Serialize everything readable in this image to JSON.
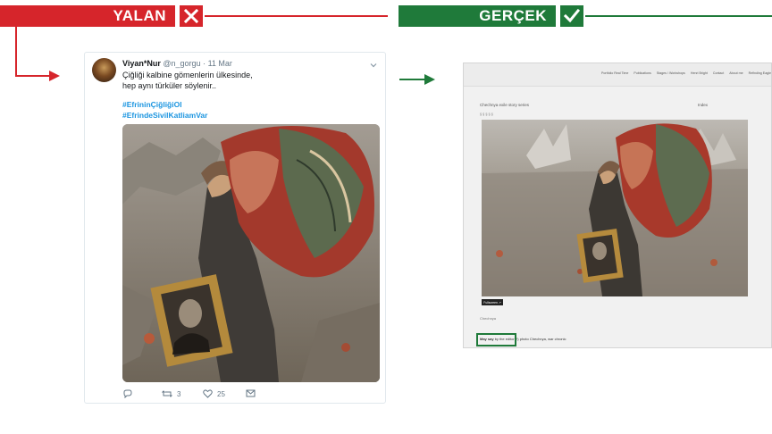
{
  "header": {
    "false_label": "YALAN",
    "true_label": "GERÇEK",
    "colors": {
      "false": "#d6252b",
      "true": "#1f7a3a"
    },
    "false_icon": "x-mark-icon",
    "true_icon": "check-mark-icon"
  },
  "tweet": {
    "name": "Viyan*Nur",
    "handle": "@n_gorgu",
    "dot": "·",
    "date": "11 Mar",
    "text_line1": "Çiğliği kalbine gömenlerin ülkesinde,",
    "text_line2": "hep aynı türküler söylenir..",
    "hashtag1": "#EfrininÇiğliğiOl",
    "hashtag2": "#EfrindeSivilKatliamVar",
    "photo_alt": "Woman carrying rugs and a framed portrait among ruins",
    "reply_count": "",
    "retweet_count": "3",
    "like_count": "25"
  },
  "site": {
    "nav": [
      "Portfolio Real Time",
      "Publications",
      "Stages / Workshops",
      "Henri Bright",
      "Contact",
      "About me",
      "Refinding Eagle"
    ],
    "title": "Chechnya exile story series",
    "info": "Index",
    "subtitle": "§ § § § §",
    "button": "Fullscreen ↗",
    "category": "Chechnya",
    "note_bold": "May say",
    "note_link": "by the editor(?)",
    "note_rest": "photo Chechnya, war chronic"
  }
}
